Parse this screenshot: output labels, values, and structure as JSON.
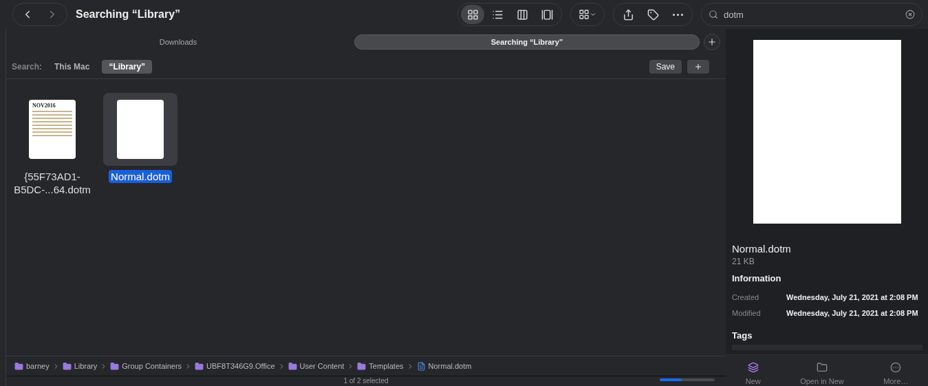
{
  "window": {
    "title": "Searching “Library”"
  },
  "view_modes": [
    {
      "kind": "icons",
      "selected": true
    },
    {
      "kind": "list",
      "selected": false
    },
    {
      "kind": "columns",
      "selected": false
    },
    {
      "kind": "gallery",
      "selected": false
    }
  ],
  "search": {
    "value": "dotm"
  },
  "tabs": [
    {
      "label": "Downloads",
      "selected": false
    },
    {
      "label": "Searching “Library”",
      "selected": true
    }
  ],
  "scope": {
    "label": "Search:",
    "options": [
      {
        "label": "This Mac",
        "selected": false
      },
      {
        "label": "“Library”",
        "selected": true
      }
    ],
    "save": "Save"
  },
  "files": [
    {
      "kind": "calendar",
      "thumbnail_title": "NOV2016",
      "name_lines": [
        "{55F73AD1-",
        "B5DC-...64.dotm"
      ],
      "selected": false
    },
    {
      "kind": "blank",
      "name_lines": [
        "Normal.dotm"
      ],
      "selected": true
    }
  ],
  "path": [
    {
      "label": "barney",
      "kind": "folder"
    },
    {
      "label": "Library",
      "kind": "folder"
    },
    {
      "label": "Group Containers",
      "kind": "folder"
    },
    {
      "label": "UBF8T346G9.Office",
      "kind": "folder"
    },
    {
      "label": "User Content",
      "kind": "folder"
    },
    {
      "label": "Templates",
      "kind": "folder"
    },
    {
      "label": "Normal.dotm",
      "kind": "document"
    }
  ],
  "status": {
    "text": "1 of 2 selected",
    "level": 0.4
  },
  "preview": {
    "name": "Normal.dotm",
    "size": "21 KB",
    "info_heading": "Information",
    "info": [
      {
        "label": "Created",
        "value": "Wednesday, July 21, 2021 at 2:08 PM"
      },
      {
        "label": "Modified",
        "value": "Wednesday, July 21, 2021 at 2:08 PM"
      }
    ],
    "tags_heading": "Tags",
    "actions": [
      {
        "label": "New",
        "kind": "new"
      },
      {
        "label": "Open in New",
        "kind": "folder"
      },
      {
        "label": "More…",
        "kind": "more"
      }
    ]
  }
}
